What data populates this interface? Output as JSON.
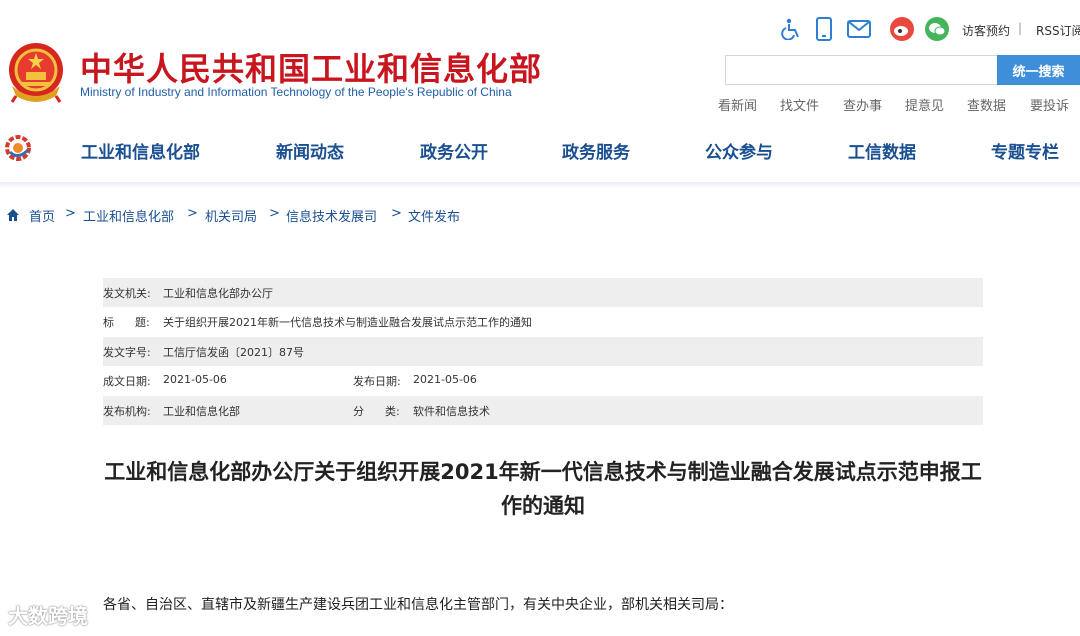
{
  "header": {
    "title": "中华人民共和国工业和信息化部",
    "subtitle": "Ministry of Industry and Information Technology of the People's Republic of China",
    "tools": {
      "icons": [
        "accessibility-icon",
        "mobile-icon",
        "mail-icon",
        "weibo-icon",
        "wechat-icon"
      ],
      "visit": "访客预约",
      "separator": "|",
      "rss": "RSS订阅"
    },
    "search": {
      "placeholder": "",
      "button": "统一搜索"
    },
    "quick_links": [
      "看新闻",
      "找文件",
      "查办事",
      "提意见",
      "查数据",
      "要投诉"
    ]
  },
  "nav": {
    "items": [
      "工业和信息化部",
      "新闻动态",
      "政务公开",
      "政务服务",
      "公众参与",
      "工信数据",
      "专题专栏"
    ]
  },
  "breadcrumb": {
    "items": [
      "首页",
      "工业和信息化部",
      "机关司局",
      "信息技术发展司",
      "文件发布"
    ],
    "separator": ">"
  },
  "meta": {
    "issuer_label": "发文机关:",
    "issuer": "工业和信息化部办公厅",
    "title_label": "标      题:",
    "title": "关于组织开展2021年新一代信息技术与制造业融合发展试点示范工作的通知",
    "docno_label": "发文字号:",
    "docno": "工信厅信发函〔2021〕87号",
    "created_label": "成文日期:",
    "created": "2021-05-06",
    "published_label": "发布日期:",
    "published": "2021-05-06",
    "org_label": "发布机构:",
    "org": "工业和信息化部",
    "category_label": "分      类:",
    "category": "软件和信息技术"
  },
  "document": {
    "title": "工业和信息化部办公厅关于组织开展2021年新一代信息技术与制造业融合发展试点示范申报工作的通知",
    "salutation": "各省、自治区、直辖市及新疆生产建设兵团工业和信息化主管部门，有关中央企业，部机关相关司局："
  },
  "watermark": "大数跨境",
  "colors": {
    "brand_red": "#c9151e",
    "nav_blue": "#1a4f91",
    "search_blue": "#3f8ed9",
    "row_shade": "#eeeeee"
  }
}
